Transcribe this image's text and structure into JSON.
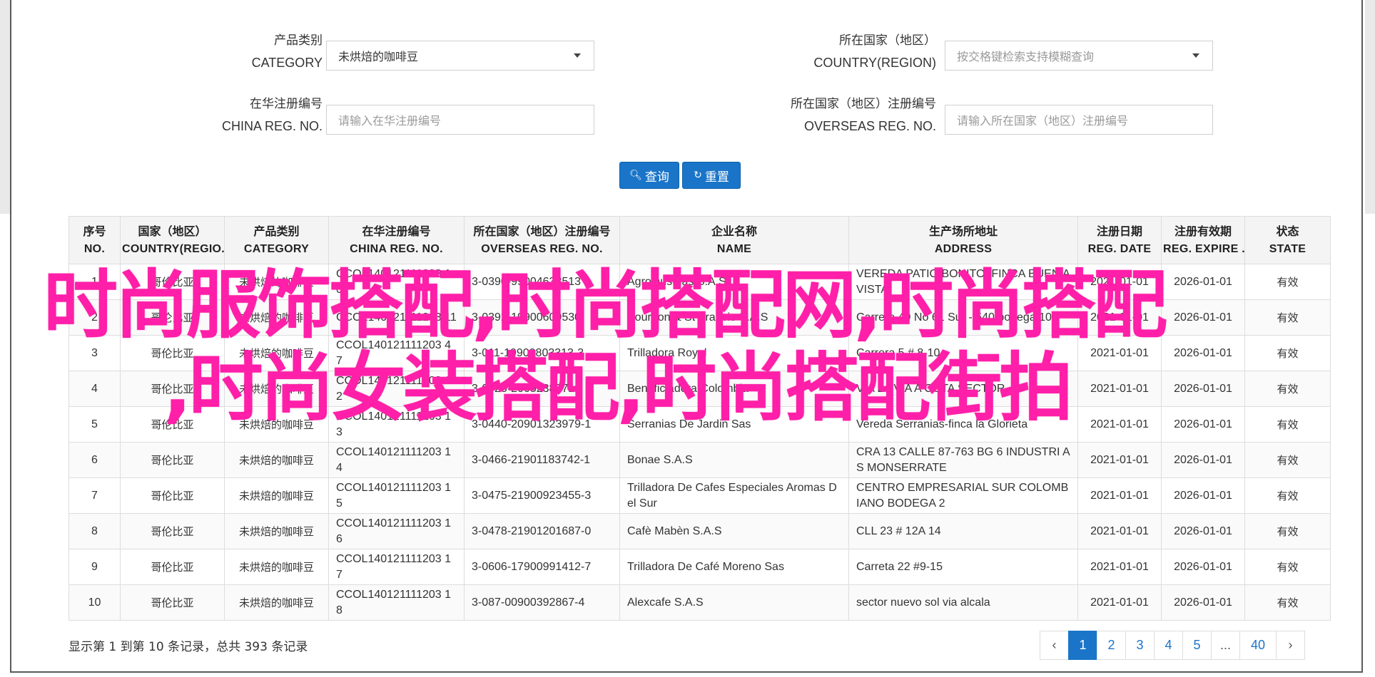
{
  "filters": {
    "category": {
      "label_cn": "产品类别",
      "label_en": "CATEGORY",
      "value": "未烘焙的咖啡豆"
    },
    "country": {
      "label_cn": "所在国家（地区）",
      "label_en": "COUNTRY(REGION)",
      "placeholder": "按交格键检索支持模糊查询"
    },
    "china_reg": {
      "label_cn": "在华注册编号",
      "label_en": "CHINA REG. NO.",
      "placeholder": "请输入在华注册编号"
    },
    "overseas_reg": {
      "label_cn": "所在国家（地区）注册编号",
      "label_en": "OVERSEAS REG. NO.",
      "placeholder": "请输入所在国家（地区）注册编号"
    }
  },
  "buttons": {
    "query": "查询",
    "reset": "重置"
  },
  "table": {
    "headers": [
      {
        "cn": "序号",
        "en": "NO."
      },
      {
        "cn": "国家（地区）",
        "en": "COUNTRY(REGIO..."
      },
      {
        "cn": "产品类别",
        "en": "CATEGORY"
      },
      {
        "cn": "在华注册编号",
        "en": "CHINA REG. NO."
      },
      {
        "cn": "所在国家（地区）注册编号",
        "en": "OVERSEAS REG. NO."
      },
      {
        "cn": "企业名称",
        "en": "NAME"
      },
      {
        "cn": "生产场所地址",
        "en": "ADDRESS"
      },
      {
        "cn": "注册日期",
        "en": "REG. DATE"
      },
      {
        "cn": "注册有效期",
        "en": "REG. EXPIRE ..."
      },
      {
        "cn": "状态",
        "en": "STATE"
      }
    ],
    "rows": [
      {
        "no": "1",
        "country": "哥伦比亚",
        "category": "未烘焙的咖啡豆",
        "china_reg": "CCOL140121111203 10",
        "overseas_reg": "3-0390-99004638513",
        "name": "Agrojnustrias S.A.S",
        "address": "VEREDA PATIO BONITO, FINCA BUEN AVISTA",
        "reg_date": "2021-01-01",
        "expire": "2026-01-01",
        "state": "有效"
      },
      {
        "no": "2",
        "country": "哥伦比亚",
        "category": "未烘焙的咖啡豆",
        "china_reg": "CCOL140121111203 11",
        "overseas_reg": "3-0392-19900609530",
        "name": "Bourbon & St Francis S.A.S",
        "address": "Carrera 49 No 61 Sur - 540 bodega 10",
        "reg_date": "2021-01-01",
        "expire": "2026-01-01",
        "state": "有效"
      },
      {
        "no": "3",
        "country": "哥伦比亚",
        "category": "未烘焙的咖啡豆",
        "china_reg": "CCOL140121111203 47",
        "overseas_reg": "3-011-19900803313-3",
        "name": "Trilladora Royal",
        "address": "Carrera 5 # 8-10",
        "reg_date": "2021-01-01",
        "expire": "2026-01-01",
        "state": "有效"
      },
      {
        "no": "4",
        "country": "哥伦比亚",
        "category": "未烘焙的咖啡豆",
        "china_reg": "CCOL140121111203 12",
        "overseas_reg": "3-0425-20052388710",
        "name": "Beneficiadora Colombia",
        "address": "VIA LA VÍA A COTA SECTOR",
        "reg_date": "2021-01-01",
        "expire": "2026-01-01",
        "state": "有效"
      },
      {
        "no": "5",
        "country": "哥伦比亚",
        "category": "未烘焙的咖啡豆",
        "china_reg": "CCOL140121111203 13",
        "overseas_reg": "3-0440-20901323979-1",
        "name": "Serranias De Jardin Sas",
        "address": "Vereda Serranias-finca la Glorieta",
        "reg_date": "2021-01-01",
        "expire": "2026-01-01",
        "state": "有效"
      },
      {
        "no": "6",
        "country": "哥伦比亚",
        "category": "未烘焙的咖啡豆",
        "china_reg": "CCOL140121111203 14",
        "overseas_reg": "3-0466-21901183742-1",
        "name": "Bonae S.A.S",
        "address": "CRA 13 CALLE 87-763 BG 6 INDUSTRI AS MONSERRATE",
        "reg_date": "2021-01-01",
        "expire": "2026-01-01",
        "state": "有效"
      },
      {
        "no": "7",
        "country": "哥伦比亚",
        "category": "未烘焙的咖啡豆",
        "china_reg": "CCOL140121111203 15",
        "overseas_reg": "3-0475-21900923455-3",
        "name": "Trilladora De Cafes Especiales Aromas Del Sur",
        "address": "CENTRO EMPRESARIAL SUR COLOMB IANO BODEGA 2",
        "reg_date": "2021-01-01",
        "expire": "2026-01-01",
        "state": "有效"
      },
      {
        "no": "8",
        "country": "哥伦比亚",
        "category": "未烘焙的咖啡豆",
        "china_reg": "CCOL140121111203 16",
        "overseas_reg": "3-0478-21901201687-0",
        "name": "Cafè Mabèn S.A.S",
        "address": "CLL 23 # 12A 14",
        "reg_date": "2021-01-01",
        "expire": "2026-01-01",
        "state": "有效"
      },
      {
        "no": "9",
        "country": "哥伦比亚",
        "category": "未烘焙的咖啡豆",
        "china_reg": "CCOL140121111203 17",
        "overseas_reg": "3-0606-17900991412-7",
        "name": "Trilladora De Café Moreno Sas",
        "address": "Carreta 22 #9-15",
        "reg_date": "2021-01-01",
        "expire": "2026-01-01",
        "state": "有效"
      },
      {
        "no": "10",
        "country": "哥伦比亚",
        "category": "未烘焙的咖啡豆",
        "china_reg": "CCOL140121111203 18",
        "overseas_reg": "3-087-00900392867-4",
        "name": "Alexcafe S.A.S",
        "address": "sector nuevo sol via alcala",
        "reg_date": "2021-01-01",
        "expire": "2026-01-01",
        "state": "有效"
      }
    ]
  },
  "summary": "显示第 1 到第 10 条记录，总共 393 条记录",
  "pagination": {
    "prev": "‹",
    "pages": [
      "1",
      "2",
      "3",
      "4",
      "5",
      "...",
      "40"
    ],
    "next": "›",
    "active": "1"
  },
  "overlay": {
    "line1": "时尚服饰搭配,时尚搭配网,时尚搭配",
    "line2": ",时尚女装搭配,时尚搭配街拍"
  },
  "colors": {
    "accent": "#1a75c9",
    "overlay": "#ff1fa8"
  }
}
